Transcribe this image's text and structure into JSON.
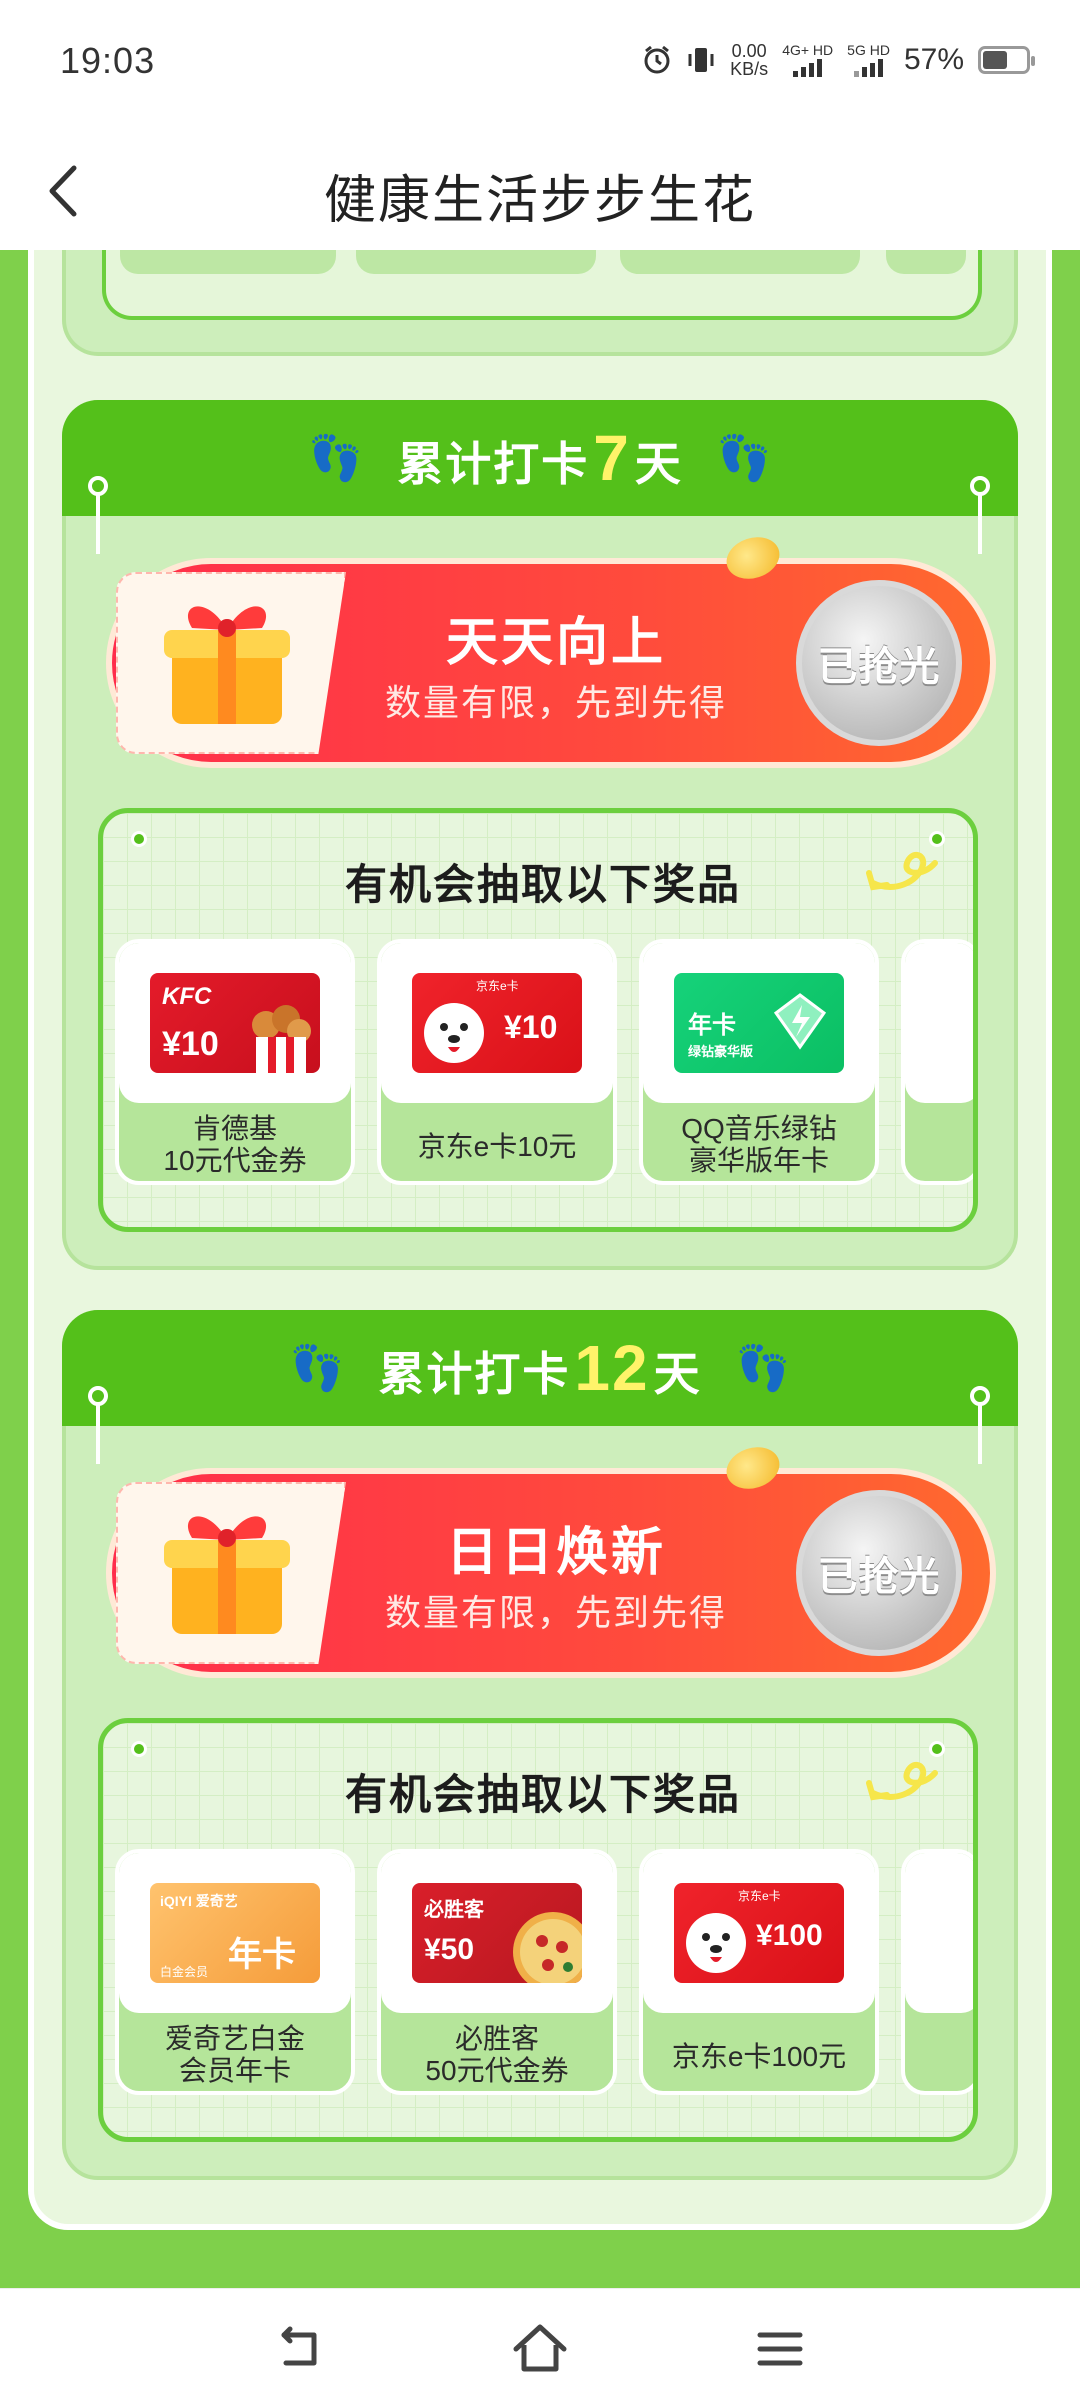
{
  "status_bar": {
    "time": "19:03",
    "net_speed_value": "0.00",
    "net_speed_unit": "KB/s",
    "sim1_label": "4G+ HD",
    "sim2_label": "5G HD",
    "battery_percent": "57%",
    "battery_level": 0.57,
    "icons": [
      "alarm-icon",
      "vibrate-icon",
      "signal-icon",
      "battery-icon"
    ]
  },
  "header": {
    "title": "健康生活步步生花",
    "back_icon": "chevron-left-icon"
  },
  "sections": [
    {
      "header_prefix": "累计打卡",
      "days": "7",
      "header_suffix": "天",
      "reward_title": "天天向上",
      "reward_subtitle": "数量有限，先到先得",
      "button_label": "已抢光",
      "prizes_title": "有机会抽取以下奖品",
      "prizes": [
        {
          "name": "肯德基\n10元代金券",
          "card_brand": "KFC",
          "card_value": "¥10"
        },
        {
          "name": "京东e卡10元",
          "card_brand": "京东e卡",
          "card_value": "¥10"
        },
        {
          "name": "QQ音乐绿钻\n豪华版年卡",
          "card_brand": "年卡",
          "card_sub": "绿钻豪华版"
        }
      ]
    },
    {
      "header_prefix": "累计打卡",
      "days": "12",
      "header_suffix": "天",
      "reward_title": "日日焕新",
      "reward_subtitle": "数量有限，先到先得",
      "button_label": "已抢光",
      "prizes_title": "有机会抽取以下奖品",
      "prizes": [
        {
          "name": "爱奇艺白金\n会员年卡",
          "card_brand": "iQIYI 爱奇艺",
          "card_value": "年卡",
          "card_sub": "白金会员"
        },
        {
          "name": "必胜客\n50元代金券",
          "card_brand": "必胜客",
          "card_value": "¥50"
        },
        {
          "name": "京东e卡100元",
          "card_brand": "京东e卡",
          "card_value": "¥100"
        }
      ]
    }
  ],
  "colors": {
    "page_green": "#7fd04b",
    "header_green": "#54c01a",
    "banner_red": "#ff2d4b",
    "highlight_yellow": "#fff36a",
    "sold_out_gray": "#c9c9c9"
  },
  "nav_bar": {
    "icons": [
      "back-nav-icon",
      "home-icon",
      "menu-icon"
    ]
  }
}
